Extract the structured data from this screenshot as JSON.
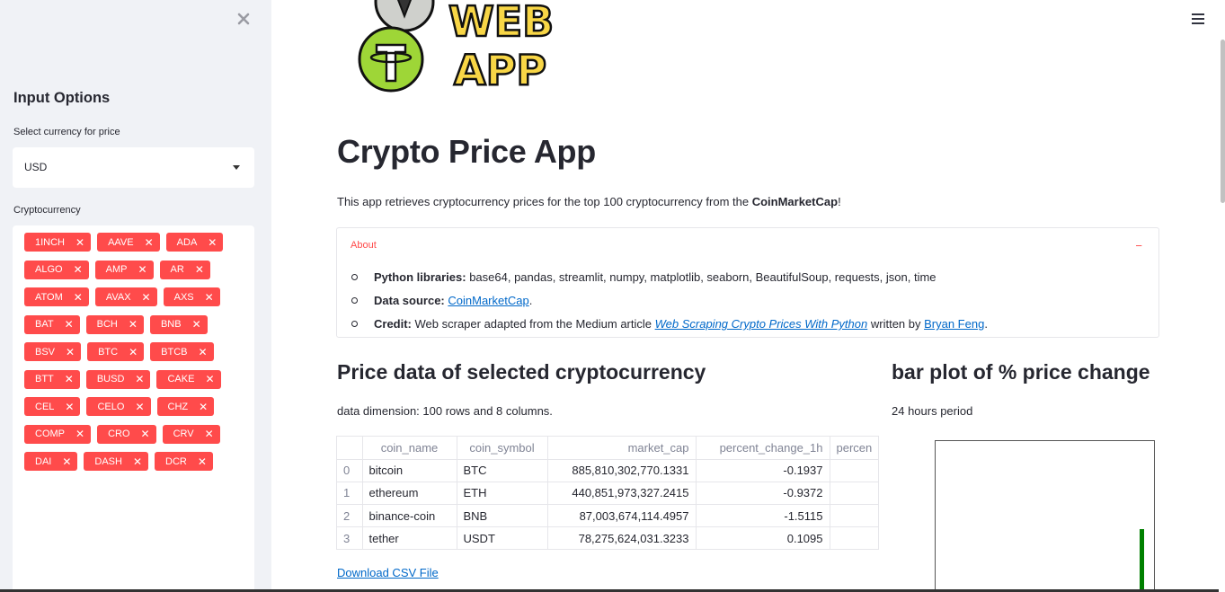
{
  "sidebar": {
    "heading": "Input Options",
    "currency_label": "Select currency for price",
    "currency_value": "USD",
    "crypto_label": "Cryptocurrency",
    "tags": [
      "1INCH",
      "AAVE",
      "ADA",
      "ALGO",
      "AMP",
      "AR",
      "ATOM",
      "AVAX",
      "AXS",
      "BAT",
      "BCH",
      "BNB",
      "BSV",
      "BTC",
      "BTCB",
      "BTT",
      "BUSD",
      "CAKE",
      "CEL",
      "CELO",
      "CHZ",
      "COMP",
      "CRO",
      "CRV",
      "DAI",
      "DASH",
      "DCR"
    ]
  },
  "main": {
    "logo_text": "WEB APP",
    "title": "Crypto Price App",
    "intro_prefix": "This app retrieves cryptocurrency prices for the top 100 cryptocurrency from the ",
    "intro_bold": "CoinMarketCap",
    "intro_suffix": "!",
    "about": {
      "header": "About",
      "toggle": "−",
      "libs_label": "Python libraries:",
      "libs_text": " base64, pandas, streamlit, numpy, matplotlib, seaborn, BeautifulSoup, requests, json, time",
      "source_label": "Data source:",
      "source_link": "CoinMarketCap",
      "source_end": ".",
      "credit_label": "Credit:",
      "credit_text": " Web scraper adapted from the Medium article ",
      "credit_article": "Web Scraping Crypto Prices With Python",
      "credit_mid": " written by ",
      "credit_author": "Bryan Feng",
      "credit_end": "."
    },
    "price_heading": "Price data of selected cryptocurrency",
    "dimension_text": "data dimension: 100 rows and 8 columns.",
    "table": {
      "columns": [
        "",
        "coin_name",
        "coin_symbol",
        "market_cap",
        "percent_change_1h",
        "percen"
      ],
      "rows": [
        [
          "0",
          "bitcoin",
          "BTC",
          "885,810,302,770.1331",
          "-0.1937",
          ""
        ],
        [
          "1",
          "ethereum",
          "ETH",
          "440,851,973,327.2415",
          "-0.9372",
          ""
        ],
        [
          "2",
          "binance-coin",
          "BNB",
          "87,003,674,114.4957",
          "-1.5115",
          ""
        ],
        [
          "3",
          "tether",
          "USDT",
          "78,275,624,031.3233",
          "0.1095",
          ""
        ]
      ]
    },
    "download_link": "Download CSV File",
    "bar_heading": "bar plot of % price change",
    "period_text": "24 hours period"
  },
  "colors": {
    "accent": "#ff4b4b",
    "link": "#0068c9",
    "sidebar_bg": "#f0f2f6",
    "bar_positive": "#008000"
  }
}
